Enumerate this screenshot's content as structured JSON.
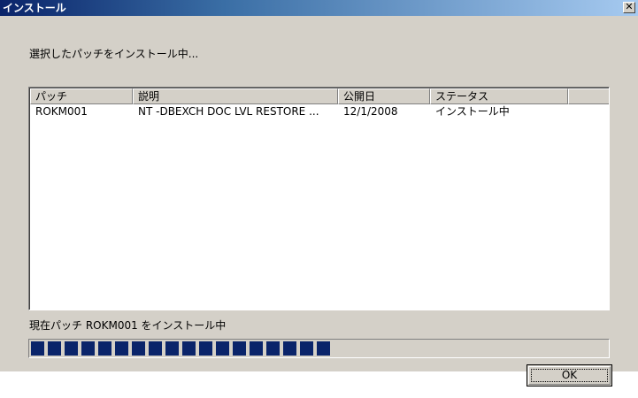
{
  "window": {
    "title": "インストール",
    "close_glyph": "✕"
  },
  "instruction": "選択したパッチをインストール中...",
  "list": {
    "columns": [
      "パッチ",
      "説明",
      "公開日",
      "ステータス",
      ""
    ],
    "rows": [
      {
        "patch": "ROKM001",
        "description": "NT -DBEXCH DOC LVL RESTORE ...",
        "date": "12/1/2008",
        "status": "インストール中"
      }
    ]
  },
  "current_patch_label": "現在パッチ ROKM001 をインストール中",
  "progress": {
    "percent": 52,
    "color": "#0a246a"
  },
  "ok_button": {
    "label": "OK"
  }
}
